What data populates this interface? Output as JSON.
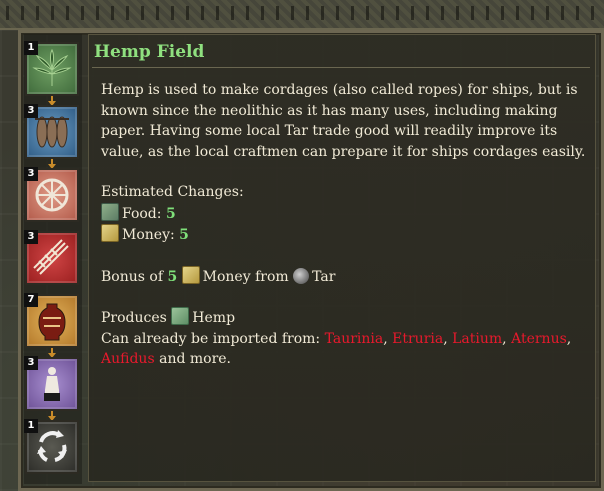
{
  "panel": {
    "title": "Hemp Field",
    "description": "Hemp is used to make cordages (also called ropes) for ships, but is known since the neolithic as it has many uses, including making paper. Having some local Tar trade good will readily improve its value, as the local craftmen can prepare it for ships cordages easily.",
    "estimated_label": "Estimated Changes:",
    "changes": [
      {
        "icon": "food-icon",
        "label": "Food:",
        "value": "5"
      },
      {
        "icon": "money-icon",
        "label": "Money:",
        "value": "5"
      }
    ],
    "bonus": {
      "prefix": "Bonus of",
      "value": "5",
      "resource": "Money from",
      "source": "Tar"
    },
    "produces": {
      "label": "Produces",
      "item": "Hemp"
    },
    "imported": {
      "label": "Can already be imported from:",
      "regions": [
        "Taurinia",
        "Etruria",
        "Latium",
        "Aternus",
        "Aufidus"
      ],
      "suffix": "and more."
    }
  },
  "sidebar": {
    "slots": [
      {
        "count": "1",
        "icon": "hemp-leaf-icon",
        "color": "#4f7a4a"
      },
      {
        "count": "3",
        "icon": "fish-icon",
        "color": "#3a6d95"
      },
      {
        "count": "3",
        "icon": "wheel-icon",
        "color": "#c06150"
      },
      {
        "count": "3",
        "icon": "rope-icon",
        "color": "#b82c2c"
      },
      {
        "count": "7",
        "icon": "amphora-icon",
        "color": "#c88a2f"
      },
      {
        "count": "3",
        "icon": "statue-icon",
        "color": "#7f62a6"
      },
      {
        "count": "1",
        "icon": "recycle-icon",
        "color": "#3b3b36"
      }
    ]
  },
  "colors": {
    "title": "#8fe07f",
    "value": "#7fe07a",
    "region": "#e8192c",
    "text": "#f1ead6"
  }
}
